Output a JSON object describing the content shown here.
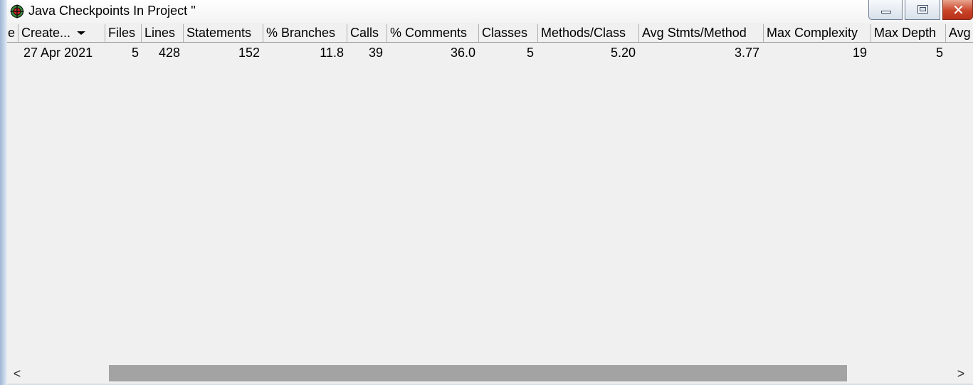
{
  "window": {
    "title": "Java Checkpoints In Project ''",
    "icon": "crosshair-target-icon",
    "controls": {
      "minimize": "minimize-icon",
      "maximize": "maximize-icon",
      "close": "✕"
    },
    "close_color": "#c9452a"
  },
  "table": {
    "columns": [
      "e",
      "Create...",
      "Files",
      "Lines",
      "Statements",
      "% Branches",
      "Calls",
      "% Comments",
      "Classes",
      "Methods/Class",
      "Avg Stmts/Method",
      "Max Complexity",
      "Max Depth",
      "Avg"
    ],
    "sorted_column": "Create...",
    "rows": [
      [
        "",
        "27 Apr 2021",
        "5",
        "428",
        "152",
        "11.8",
        "39",
        "36.0",
        "5",
        "5.20",
        "3.77",
        "19",
        "5",
        ""
      ]
    ]
  },
  "scrollbar": {
    "left_arrow": "<",
    "right_arrow": ">",
    "thumb_color": "#a3a3a3"
  }
}
